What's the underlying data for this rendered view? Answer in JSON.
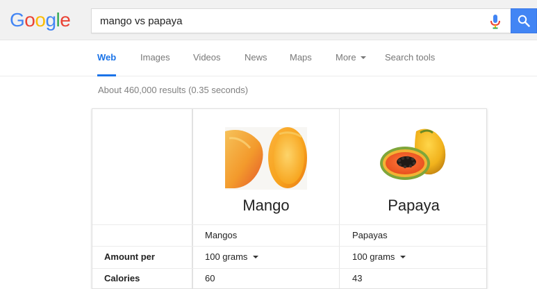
{
  "logo": {
    "letters": [
      "G",
      "o",
      "o",
      "g",
      "l",
      "e"
    ],
    "colors": [
      "#4285f4",
      "#ea4335",
      "#fbbc05",
      "#4285f4",
      "#34a853",
      "#ea4335"
    ]
  },
  "search": {
    "query": "mango vs papaya",
    "mic_icon": "microphone-icon",
    "button_icon": "search-icon",
    "button_color": "#4285f4"
  },
  "tabs": [
    {
      "label": "Web",
      "active": true
    },
    {
      "label": "Images",
      "active": false
    },
    {
      "label": "Videos",
      "active": false
    },
    {
      "label": "News",
      "active": false
    },
    {
      "label": "Maps",
      "active": false
    },
    {
      "label": "More",
      "active": false,
      "has_caret": true
    },
    {
      "label": "Search tools",
      "active": false
    }
  ],
  "result_stats": "About 460,000 results (0.35 seconds)",
  "comparison": {
    "fruits": [
      {
        "name": "Mango",
        "subtitle": "Mangos",
        "serving": "100 grams",
        "calories": "60"
      },
      {
        "name": "Papaya",
        "subtitle": "Papayas",
        "serving": "100 grams",
        "calories": "43"
      }
    ],
    "rows": {
      "amount_per": "Amount per",
      "calories": "Calories"
    }
  },
  "colors": {
    "accent": "#1a73e8",
    "header_bg": "#f1f1f1"
  }
}
